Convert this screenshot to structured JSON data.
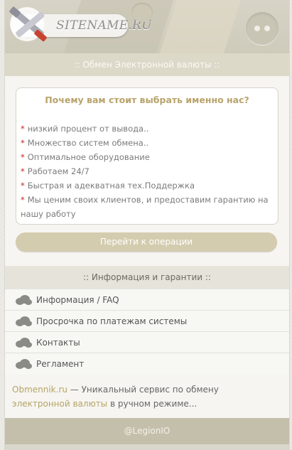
{
  "header": {
    "logo_text": "SITENAME.RU"
  },
  "top_bar": {
    "title": ":: Обмен Электронной валюты ::"
  },
  "card": {
    "title": "Почему вам стоит выбрать именно нас?",
    "bullet_marker": "*",
    "items": [
      "низкий процент от вывода..",
      "Множество систем обмена..",
      "Оптимальное оборудование",
      "Работаем 24/7",
      "Быстрая и адекватная тех.Поддержка",
      "Мы ценим своих клиентов, и предоставим гарантию на нашу работу"
    ]
  },
  "go_button": {
    "label": "Перейти к операции"
  },
  "info_bar": {
    "title": ":: Информация и гарантии ::"
  },
  "nav": [
    {
      "label": "Информация / FAQ",
      "icon": "cloud-icon"
    },
    {
      "label": "Просрочка по платежам системы",
      "icon": "cloud-icon"
    },
    {
      "label": "Контакты",
      "icon": "cloud-icon"
    },
    {
      "label": "Регламент",
      "icon": "cloud-icon"
    }
  ],
  "footer": {
    "site": "Obmennik.ru",
    "text1": " — Уникальный сервис по обмену",
    "accent2": "электронной валюты",
    "text2": " в ручном режиме..."
  },
  "bottom_bar": {
    "credit": "@LegionIO"
  },
  "colors": {
    "accent": "#b8a36b",
    "bullet": "#c12525",
    "button": "#d4ccae",
    "bottom_bar": "#c4bfab"
  }
}
